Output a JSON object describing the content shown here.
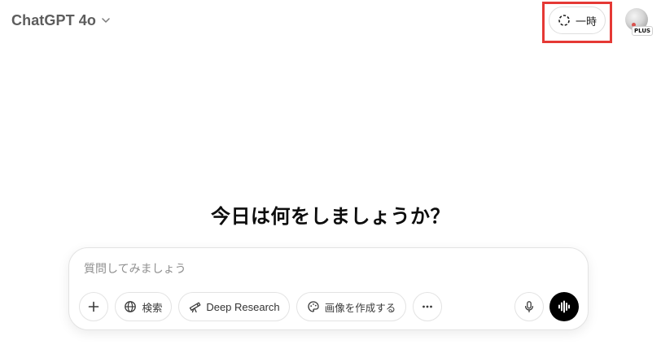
{
  "header": {
    "model_name": "ChatGPT 4o",
    "temporary_chat_label": "一時",
    "plan_badge": "PLUS"
  },
  "main": {
    "greeting": "今日は何をしましょうか？"
  },
  "composer": {
    "placeholder": "質問してみましょう",
    "value": "",
    "tools": {
      "search_label": "検索",
      "deep_research_label": "Deep Research",
      "create_image_label": "画像を作成する"
    }
  },
  "icons": {
    "model_dropdown": "chevron-down-icon",
    "temporary_chat": "dashed-circle-icon",
    "add": "plus-icon",
    "search": "globe-icon",
    "deep_research": "telescope-icon",
    "create_image": "palette-icon",
    "more": "ellipsis-icon",
    "dictate": "microphone-icon",
    "voice_mode": "waveform-icon"
  },
  "colors": {
    "highlight_box": "#e53935",
    "voice_button": "#000000",
    "text_primary": "#0d0d0d",
    "text_muted": "#5d5d5d"
  }
}
